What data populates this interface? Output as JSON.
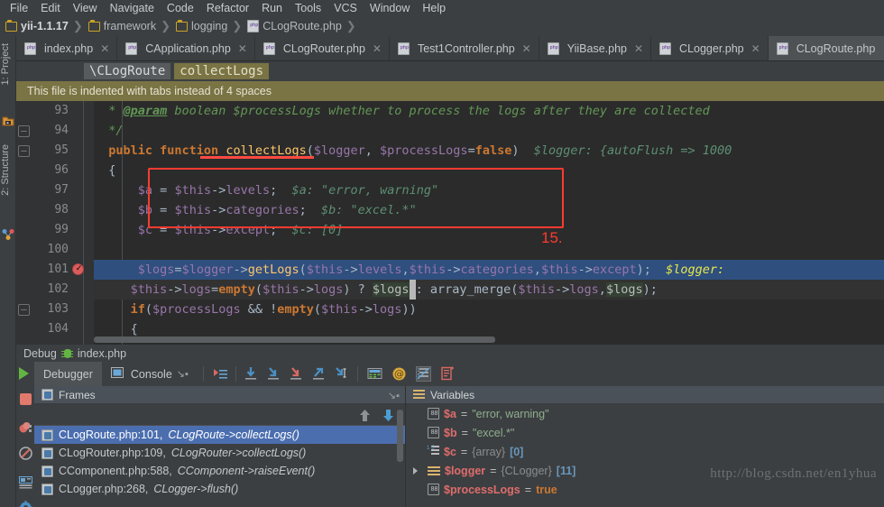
{
  "menu": {
    "items": [
      "File",
      "Edit",
      "View",
      "Navigate",
      "Code",
      "Refactor",
      "Run",
      "Tools",
      "VCS",
      "Window",
      "Help"
    ]
  },
  "breadcrumb": {
    "items": [
      {
        "label": "yii-1.1.17",
        "icon": "folder-icon",
        "bold": true
      },
      {
        "label": "framework",
        "icon": "folder-icon",
        "bold": false
      },
      {
        "label": "logging",
        "icon": "folder-icon",
        "bold": false
      },
      {
        "label": "CLogRoute.php",
        "icon": "php-file-icon",
        "bold": false
      }
    ]
  },
  "tabs": [
    {
      "label": "index.php",
      "active": false
    },
    {
      "label": "CApplication.php",
      "active": false
    },
    {
      "label": "CLogRouter.php",
      "active": false
    },
    {
      "label": "Test1Controller.php",
      "active": false
    },
    {
      "label": "YiiBase.php",
      "active": false
    },
    {
      "label": "CLogger.php",
      "active": false
    },
    {
      "label": "CLogRoute.php",
      "active": true
    }
  ],
  "left_strip": {
    "project_tab": "1: Project",
    "structure_tab": "2: Structure"
  },
  "structure_bar": {
    "class_chip": "\\CLogRoute",
    "method_chip": "collectLogs"
  },
  "notice": {
    "text": "This file is indented with tabs instead of 4 spaces"
  },
  "editor": {
    "line_numbers": [
      93,
      94,
      95,
      96,
      97,
      98,
      99,
      100,
      101,
      102,
      103,
      104
    ],
    "breakpoint_line": 101,
    "highlight_line": 101,
    "annotation": "15.",
    "lines": [
      {
        "n": 93,
        "text": " * @param boolean $processLogs whether to process the logs after they are collected"
      },
      {
        "n": 94,
        "text": " */"
      },
      {
        "n": 95,
        "text": "public function collectLogs($logger, $processLogs=false)   $logger: {autoFlush => 1000"
      },
      {
        "n": 96,
        "text": "{"
      },
      {
        "n": 97,
        "text": "    $a = $this->levels;  $a: \"error, warning\""
      },
      {
        "n": 98,
        "text": "    $b = $this->categories;  $b: \"excel.*\""
      },
      {
        "n": 99,
        "text": "    $c = $this->except;  $c: [0]"
      },
      {
        "n": 100,
        "text": ""
      },
      {
        "n": 101,
        "text": "    $logs=$logger->getLogs($this->levels,$this->categories,$this->except);   $logger:"
      },
      {
        "n": 102,
        "text": "    $this->logs=empty($this->logs) ? $logs : array_merge($this->logs,$logs);"
      },
      {
        "n": 103,
        "text": "    if($processLogs && !empty($this->logs))"
      },
      {
        "n": 104,
        "text": "    {"
      }
    ],
    "inline_hints": {
      "line95": "$logger: {autoFlush => 1000",
      "line97": "$a: \"error, warning\"",
      "line98": "$b: \"excel.*\"",
      "line99": "$c: [0]",
      "line101": "$logger:"
    }
  },
  "debug": {
    "title": "Debug",
    "title_icon": "bug-icon",
    "config_name": "index.php",
    "tabs": [
      {
        "label": "Debugger",
        "active": true,
        "icon": null
      },
      {
        "label": "Console",
        "active": false,
        "icon": "console-icon"
      }
    ],
    "toolbar_icons": [
      "show-execution-point-icon",
      "step-over-icon",
      "step-into-icon",
      "force-step-into-icon",
      "step-out-icon",
      "run-to-cursor-icon",
      "evaluate-expression-icon",
      "watches-icon",
      "mute-breakpoints-icon",
      "settings-icon"
    ],
    "side_icons": [
      "resume-program-icon",
      "stop-icon",
      "view-breakpoints-icon",
      "mute-breakpoints-icon",
      "restore-layout-icon",
      "settings-gear-icon"
    ],
    "frames": {
      "title": "Frames",
      "title_icon": "frames-icon",
      "rows": [
        {
          "file": "CLogRoute.php:101,",
          "method": "CLogRoute->collectLogs()",
          "selected": true
        },
        {
          "file": "CLogRouter.php:109,",
          "method": "CLogRouter->collectLogs()",
          "selected": false
        },
        {
          "file": "CComponent.php:588,",
          "method": "CComponent->raiseEvent()",
          "selected": false
        },
        {
          "file": "CLogger.php:268,",
          "method": "CLogger->flush()",
          "selected": false
        }
      ]
    },
    "variables": {
      "title": "Variables",
      "title_icon": "variables-icon",
      "rows": [
        {
          "icon": "primitive-icon",
          "name": "$a",
          "eq": "=",
          "value": "\"error, warning\"",
          "value_type": "string",
          "expandable": false
        },
        {
          "icon": "primitive-icon",
          "name": "$b",
          "eq": "=",
          "value": "\"excel.*\"",
          "value_type": "string",
          "expandable": false
        },
        {
          "icon": "array-icon",
          "name": "$c",
          "eq": "=",
          "value": "{array}",
          "suffix": "[0]",
          "value_type": "array",
          "expandable": false
        },
        {
          "icon": "object-icon",
          "name": "$logger",
          "eq": "=",
          "value": "{CLogger}",
          "suffix": "[11]",
          "value_type": "object",
          "expandable": true
        },
        {
          "icon": "primitive-icon",
          "name": "$processLogs",
          "eq": "=",
          "value": "true",
          "value_type": "bool",
          "expandable": false
        }
      ]
    },
    "watermark": "http://blog.csdn.net/en1yhua"
  }
}
